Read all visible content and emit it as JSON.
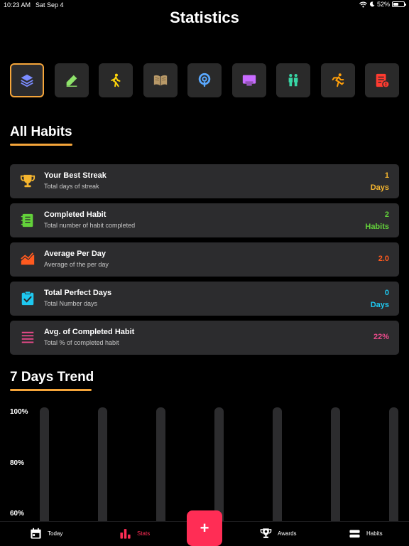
{
  "status_bar": {
    "time": "10:23 AM",
    "date": "Sat Sep 4",
    "battery": "52%",
    "battery_level": 0.52
  },
  "header": {
    "title": "Statistics"
  },
  "categories": [
    {
      "icon": "layers-icon",
      "active": true,
      "color": "#7b8cff"
    },
    {
      "icon": "pencil-icon",
      "active": false,
      "color": "#8fe36b"
    },
    {
      "icon": "walking-icon",
      "active": false,
      "color": "#ffd60a"
    },
    {
      "icon": "book-icon",
      "active": false,
      "color": "#b89968"
    },
    {
      "icon": "podcast-icon",
      "active": false,
      "color": "#5aa9ff"
    },
    {
      "icon": "monitor-icon",
      "active": false,
      "color": "#c86bff"
    },
    {
      "icon": "people-icon",
      "active": false,
      "color": "#38d6a5"
    },
    {
      "icon": "running-icon",
      "active": false,
      "color": "#ff9f0a"
    },
    {
      "icon": "clipboard-alert-icon",
      "active": false,
      "color": "#ff3b30"
    }
  ],
  "all_habits": {
    "title": "All Habits",
    "stats": [
      {
        "icon": "trophy-icon",
        "label": "Your Best Streak",
        "sub": "Total days of streak",
        "value": "1",
        "unit": "Days",
        "color": "#f5b52e"
      },
      {
        "icon": "notebook-icon",
        "label": "Completed Habit",
        "sub": "Total number of habit completed",
        "value": "2",
        "unit": "Habits",
        "color": "#63d23a"
      },
      {
        "icon": "trend-chart-icon",
        "label": "Average Per Day",
        "sub": "Average of the per day",
        "value": "2.0",
        "unit": "",
        "color": "#ff5a1f"
      },
      {
        "icon": "clipboard-check-icon",
        "label": "Total Perfect Days",
        "sub": "Total Number days",
        "value": "0",
        "unit": "Days",
        "color": "#1ec8f0"
      },
      {
        "icon": "list-lines-icon",
        "label": "Avg. of Completed Habit",
        "sub": "Total % of completed habit",
        "value": "22%",
        "unit": "",
        "color": "#e84a8a"
      }
    ]
  },
  "trend": {
    "title": "7 Days Trend"
  },
  "chart_data": {
    "type": "bar",
    "categories": [
      "",
      "",
      "",
      "",
      "",
      "",
      ""
    ],
    "values": [
      0,
      0,
      0,
      0,
      0,
      0,
      0
    ],
    "ytick_labels": [
      "100%",
      "80%",
      "60%"
    ],
    "ylim": [
      0,
      100
    ],
    "grid": false
  },
  "tabbar": {
    "tabs": [
      {
        "icon": "calendar-icon",
        "label": "Today",
        "active": false
      },
      {
        "icon": "stats-bars-icon",
        "label": "Stats",
        "active": true
      },
      {
        "icon": "award-icon",
        "label": "Awards",
        "active": false
      },
      {
        "icon": "habits-list-icon",
        "label": "Habits",
        "active": false
      }
    ],
    "fab_label": "+"
  }
}
